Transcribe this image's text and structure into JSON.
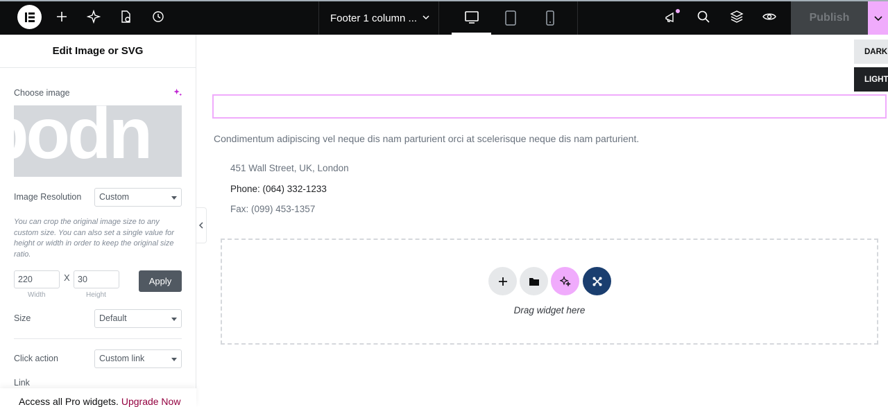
{
  "topbar": {
    "document_title": "Footer 1 column ...",
    "publish_label": "Publish",
    "icons": [
      "elementor-logo-icon",
      "add-element-icon",
      "site-settings-icon",
      "page-settings-icon",
      "history-icon",
      "desktop-icon",
      "tablet-icon",
      "mobile-icon",
      "notifications-icon",
      "search-icon",
      "structure-icon",
      "preview-icon",
      "chevron-down-icon"
    ],
    "active_device": "desktop"
  },
  "panel": {
    "title": "Edit Image or SVG",
    "choose_image_label": "Choose image",
    "image_preview_text": "podn",
    "resolution_label": "Image Resolution",
    "resolution_value": "Custom",
    "resolution_hint": "You can crop the original image size to any custom size. You can also set a single value for height or width in order to keep the original size ratio.",
    "width_value": "220",
    "height_value": "30",
    "x_separator": "X",
    "width_label": "Width",
    "height_label": "Height",
    "apply_label": "Apply",
    "size_label": "Size",
    "size_value": "Default",
    "click_action_label": "Click action",
    "click_action_value": "Custom link",
    "link_label": "Link",
    "promo_text": "Access all Pro widgets.",
    "promo_link": "Upgrade Now"
  },
  "canvas": {
    "mode_dark": "DARK",
    "mode_light": "LIGHT",
    "description": "Condimentum adipiscing vel neque dis nam parturient orci at scelerisque neque dis nam parturient.",
    "address": "451 Wall Street, UK, London",
    "phone": "Phone: (064) 332-1233",
    "fax": "Fax: (099) 453-1357",
    "drop_label": "Drag widget here"
  },
  "colors": {
    "accent_pink": "#f0abfc",
    "dark_bar": "#0c0d0e",
    "ai_blue": "#1a3e6f"
  }
}
